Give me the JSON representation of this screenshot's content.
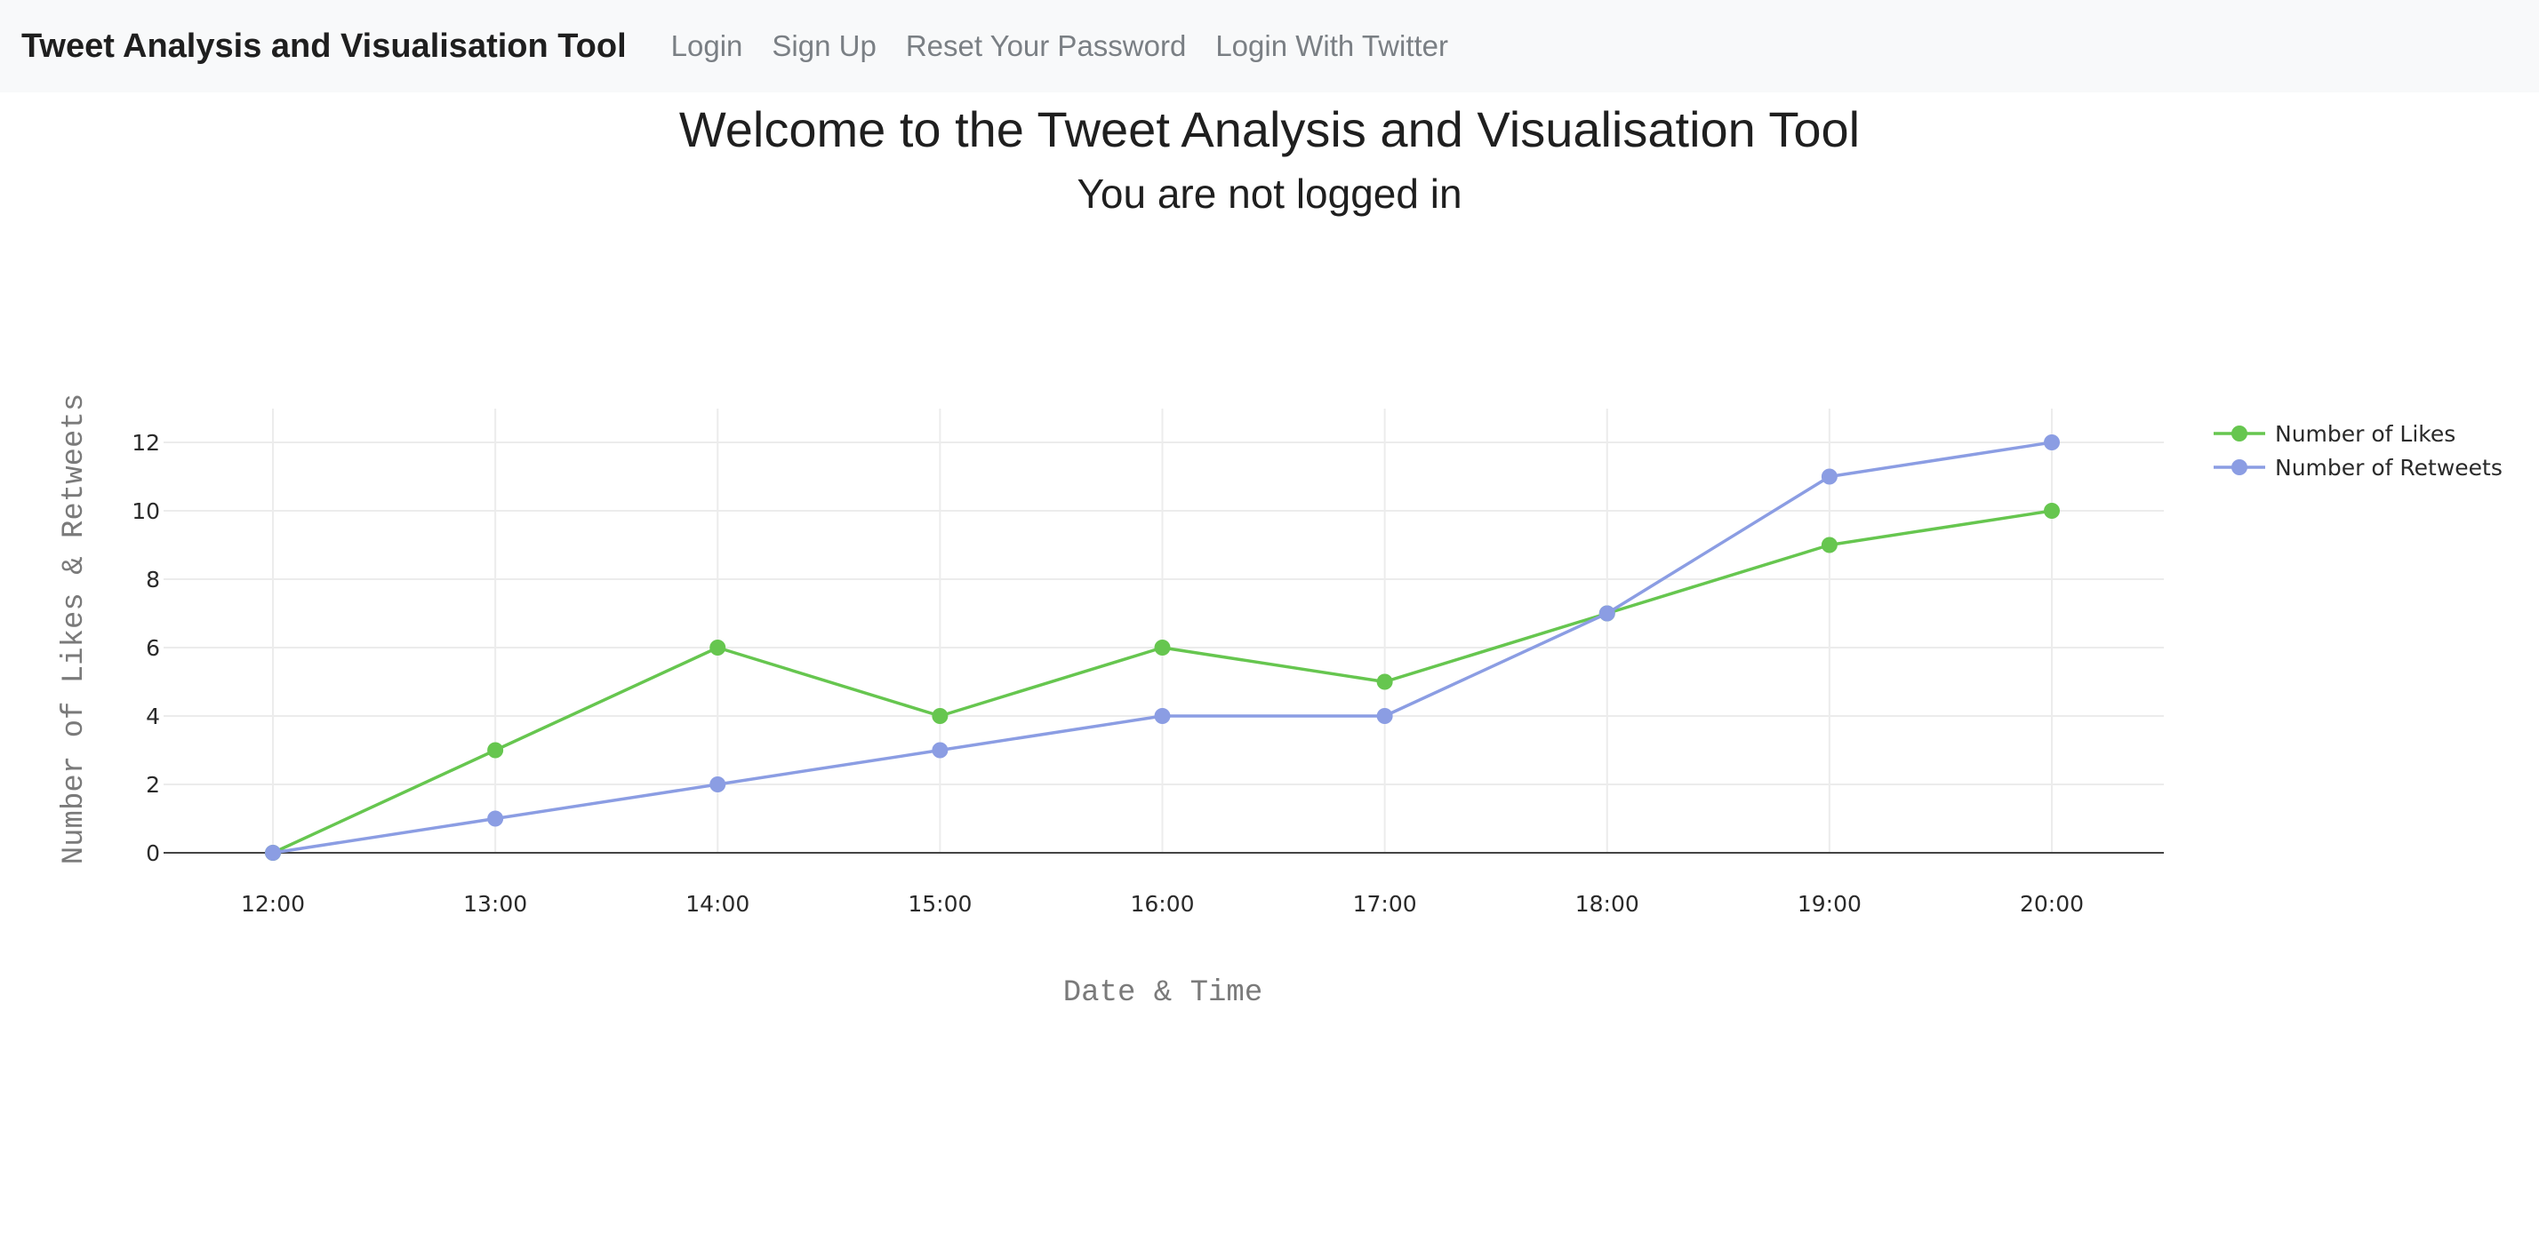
{
  "navbar": {
    "brand": "Tweet Analysis and Visualisation Tool",
    "links": [
      "Login",
      "Sign Up",
      "Reset Your Password",
      "Login With Twitter"
    ]
  },
  "main": {
    "title": "Welcome to the Tweet Analysis and Visualisation Tool",
    "subtitle": "You are not logged in"
  },
  "chart_data": {
    "type": "line",
    "x": [
      "12:00",
      "13:00",
      "14:00",
      "15:00",
      "16:00",
      "17:00",
      "18:00",
      "19:00",
      "20:00"
    ],
    "series": [
      {
        "name": "Number of Likes",
        "color": "#66c64f",
        "values": [
          0,
          3,
          6,
          4,
          6,
          5,
          7,
          9,
          10
        ]
      },
      {
        "name": "Number of Retweets",
        "color": "#8b9de3",
        "values": [
          0,
          1,
          2,
          3,
          4,
          4,
          7,
          11,
          12
        ]
      }
    ],
    "yticks": [
      0,
      2,
      4,
      6,
      8,
      10,
      12
    ],
    "ylim": [
      0,
      13
    ],
    "xlabel": "Date & Time",
    "ylabel": "Number of Likes & Retweets",
    "grid": true,
    "legend": "top-right"
  }
}
